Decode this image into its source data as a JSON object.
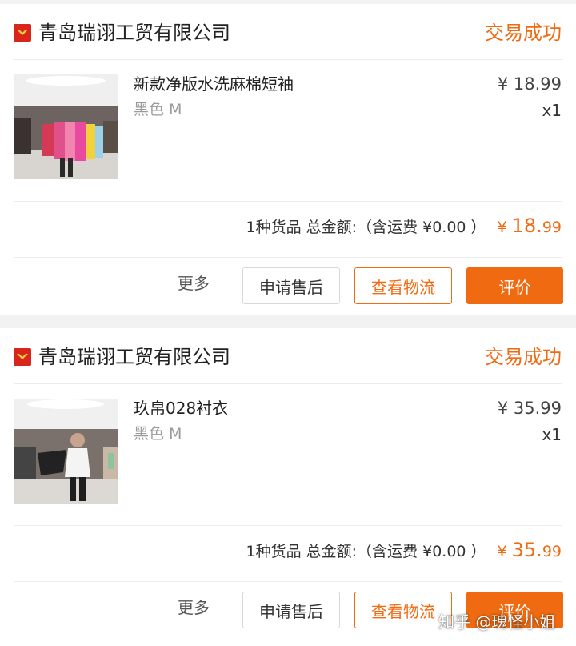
{
  "colors": {
    "accent": "#f06a12",
    "shop_badge": "#d9261c",
    "review_button": "#ef6a10"
  },
  "orders": [
    {
      "shop_name": "青岛瑞诩工贸有限公司",
      "status": "交易成功",
      "item": {
        "title": "新款净版水洗麻棉短袖",
        "sku": "黑色 M",
        "price": "¥ 18.99",
        "qty": "x1"
      },
      "summary": "1种货品 总金额:（含运费 ¥0.00 ）",
      "total": {
        "currency": "¥",
        "integer": "18.",
        "decimal": "99"
      },
      "actions": {
        "more": "更多",
        "after_sale": "申请售后",
        "logistics": "查看物流",
        "review": "评价"
      }
    },
    {
      "shop_name": "青岛瑞诩工贸有限公司",
      "status": "交易成功",
      "item": {
        "title": "玖帛028衬衣",
        "sku": "黑色 M",
        "price": "¥ 35.99",
        "qty": "x1"
      },
      "summary": "1种货品 总金额:（含运费 ¥0.00 ）",
      "total": {
        "currency": "¥",
        "integer": "35.",
        "decimal": "99"
      },
      "actions": {
        "more": "更多",
        "after_sale": "申请售后",
        "logistics": "查看物流",
        "review": "评价"
      }
    }
  ],
  "watermark": "知乎 @瑰怪小姐"
}
